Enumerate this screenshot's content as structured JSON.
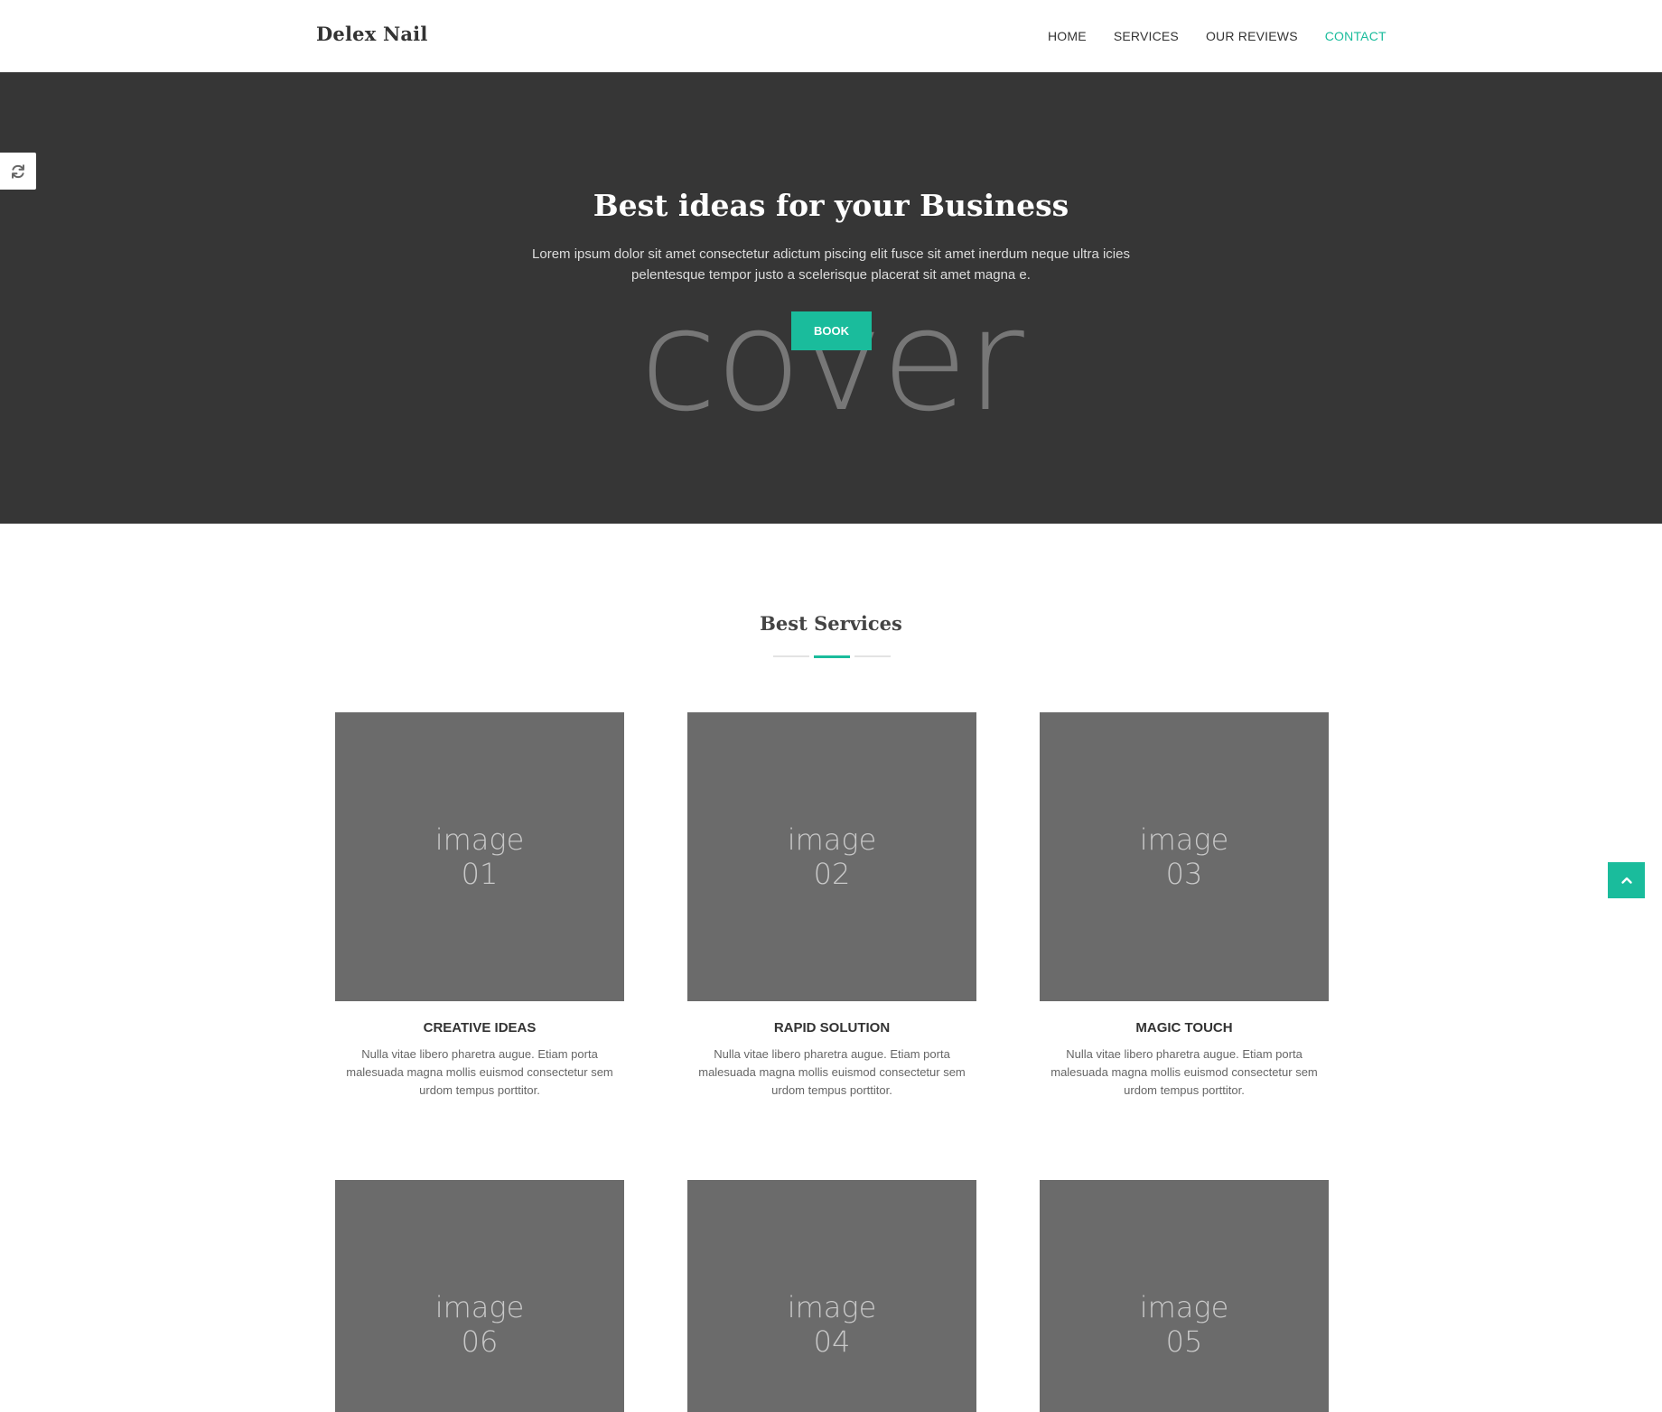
{
  "header": {
    "logo": "Delex Nail",
    "nav": [
      {
        "label": "HOME",
        "active": false
      },
      {
        "label": "SERVICES",
        "active": false
      },
      {
        "label": "OUR REVIEWS",
        "active": false
      },
      {
        "label": "CONTACT",
        "active": true
      }
    ]
  },
  "hero": {
    "background_word": "cover",
    "title": "Best ideas for your Business",
    "text": "Lorem ipsum dolor sit amet consectetur adictum piscing elit fusce sit amet inerdum neque ultra icies pelentesque tempor justo a scelerisque placerat sit amet magna e.",
    "button_label": "BOOK"
  },
  "services": {
    "title": "Best Services",
    "cards": [
      {
        "image_label": "image\n01",
        "title": "CREATIVE IDEAS",
        "desc": "Nulla vitae libero pharetra augue. Etiam porta malesuada magna mollis euismod consectetur sem urdom tempus porttitor."
      },
      {
        "image_label": "image\n02",
        "title": "RAPID SOLUTION",
        "desc": "Nulla vitae libero pharetra augue. Etiam porta malesuada magna mollis euismod consectetur sem urdom tempus porttitor."
      },
      {
        "image_label": "image\n03",
        "title": "MAGIC TOUCH",
        "desc": "Nulla vitae libero pharetra augue. Etiam porta malesuada magna mollis euismod consectetur sem urdom tempus porttitor."
      },
      {
        "image_label": "image\n06"
      },
      {
        "image_label": "image\n04"
      },
      {
        "image_label": "image\n05"
      }
    ]
  },
  "widgets": {
    "refresh_icon": "refresh-icon",
    "scroll_top_icon": "chevron-up-icon"
  },
  "colors": {
    "accent": "#1abc9c",
    "hero_bg": "#363636",
    "placeholder_bg": "#6b6b6b"
  }
}
